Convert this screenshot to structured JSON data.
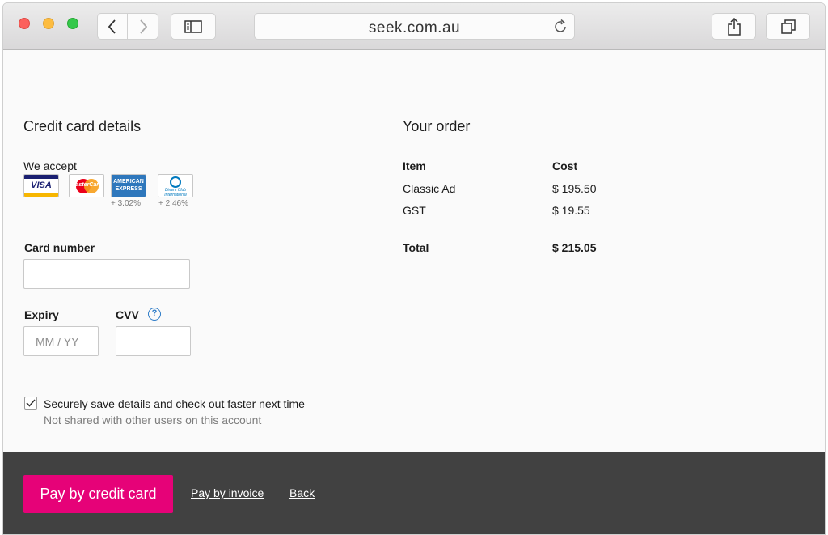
{
  "browser": {
    "url": "seek.com.au"
  },
  "payment": {
    "title": "Credit card details",
    "we_accept": "We accept",
    "cards": [
      {
        "name": "VISA",
        "fee": ""
      },
      {
        "name": "MasterCard",
        "fee": ""
      },
      {
        "name": "AMERICAN EXPRESS",
        "fee": "+ 3.02%"
      },
      {
        "name": "Diners Club International",
        "fee": "+ 2.46%"
      }
    ],
    "card_number_label": "Card number",
    "expiry_label": "Expiry",
    "expiry_placeholder": "MM / YY",
    "cvv_label": "CVV",
    "cvv_help": "?",
    "save_label": "Securely save details and check out faster next time",
    "save_sub": "Not shared with other users on this account",
    "save_checked": true
  },
  "order": {
    "title": "Your order",
    "columns": [
      "Item",
      "Cost"
    ],
    "rows": [
      {
        "item": "Classic Ad",
        "cost": "$ 195.50"
      },
      {
        "item": "GST",
        "cost": "$ 19.55"
      }
    ],
    "total_label": "Total",
    "total_value": "$ 215.05"
  },
  "footer": {
    "pay_button": "Pay by credit card",
    "invoice_link": "Pay by invoice",
    "back_link": "Back"
  },
  "colors": {
    "accent": "#e60278",
    "footer_bg": "#414141",
    "help_blue": "#2e7cc8"
  }
}
